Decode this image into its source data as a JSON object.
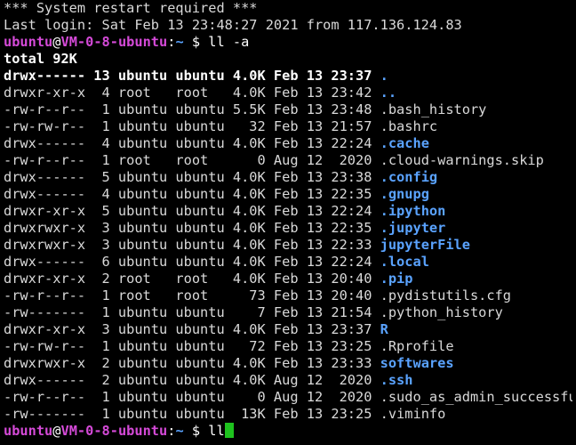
{
  "messages": {
    "restart": "*** System restart required ***",
    "last_login": "Last login: Sat Feb 13 23:48:27 2021 from 117.136.124.83"
  },
  "prompt": {
    "user": "ubuntu",
    "at": "@",
    "host": "VM-0-8-ubuntu",
    "colon": ":",
    "path": "~",
    "symbol": " $ "
  },
  "command1": "ll -a",
  "total": "total 92K",
  "files": [
    {
      "meta": "drwx------ 13 ubuntu ubuntu 4.0K Feb 13 23:37 ",
      "name": ".",
      "type": "dir",
      "bold_meta": true
    },
    {
      "meta": "drwxr-xr-x  4 root   root   4.0K Feb 13 23:42 ",
      "name": "..",
      "type": "dir"
    },
    {
      "meta": "-rw-r--r--  1 ubuntu ubuntu 5.5K Feb 13 23:48 ",
      "name": ".bash_history",
      "type": "file"
    },
    {
      "meta": "-rw-rw-r--  1 ubuntu ubuntu   32 Feb 13 21:57 ",
      "name": ".bashrc",
      "type": "file"
    },
    {
      "meta": "drwx------  4 ubuntu ubuntu 4.0K Feb 13 22:24 ",
      "name": ".cache",
      "type": "dir"
    },
    {
      "meta": "-rw-r--r--  1 root   root      0 Aug 12  2020 ",
      "name": ".cloud-warnings.skip",
      "type": "file"
    },
    {
      "meta": "drwx------  5 ubuntu ubuntu 4.0K Feb 13 23:38 ",
      "name": ".config",
      "type": "dir"
    },
    {
      "meta": "drwx------  4 ubuntu ubuntu 4.0K Feb 13 22:35 ",
      "name": ".gnupg",
      "type": "dir"
    },
    {
      "meta": "drwxr-xr-x  5 ubuntu ubuntu 4.0K Feb 13 22:24 ",
      "name": ".ipython",
      "type": "dir"
    },
    {
      "meta": "drwxrwxr-x  3 ubuntu ubuntu 4.0K Feb 13 22:35 ",
      "name": ".jupyter",
      "type": "dir"
    },
    {
      "meta": "drwxrwxr-x  3 ubuntu ubuntu 4.0K Feb 13 22:33 ",
      "name": "jupyterFile",
      "type": "dir"
    },
    {
      "meta": "drwx------  6 ubuntu ubuntu 4.0K Feb 13 22:24 ",
      "name": ".local",
      "type": "dir"
    },
    {
      "meta": "drwxr-xr-x  2 root   root   4.0K Feb 13 20:40 ",
      "name": ".pip",
      "type": "dir"
    },
    {
      "meta": "-rw-r--r--  1 root   root     73 Feb 13 20:40 ",
      "name": ".pydistutils.cfg",
      "type": "file"
    },
    {
      "meta": "-rw-------  1 ubuntu ubuntu    7 Feb 13 21:54 ",
      "name": ".python_history",
      "type": "file"
    },
    {
      "meta": "drwxr-xr-x  3 ubuntu ubuntu 4.0K Feb 13 23:37 ",
      "name": "R",
      "type": "dir"
    },
    {
      "meta": "-rw-rw-r--  1 ubuntu ubuntu   72 Feb 13 23:25 ",
      "name": ".Rprofile",
      "type": "file"
    },
    {
      "meta": "drwxrwxr-x  2 ubuntu ubuntu 4.0K Feb 13 23:33 ",
      "name": "softwares",
      "type": "dir"
    },
    {
      "meta": "drwx------  2 ubuntu ubuntu 4.0K Aug 12  2020 ",
      "name": ".ssh",
      "type": "dir"
    },
    {
      "meta": "-rw-r--r--  1 ubuntu ubuntu    0 Aug 12  2020 ",
      "name": ".sudo_as_admin_successful",
      "type": "file"
    },
    {
      "meta": "-rw-------  1 ubuntu ubuntu  13K Feb 13 23:25 ",
      "name": ".viminfo",
      "type": "file"
    }
  ],
  "command2": "ll",
  "colors": {
    "background": "#000000",
    "text": "#d9d9d9",
    "prompt_user": "#d54ad8",
    "directory": "#5aa3ff",
    "cursor": "#1ec21e"
  }
}
